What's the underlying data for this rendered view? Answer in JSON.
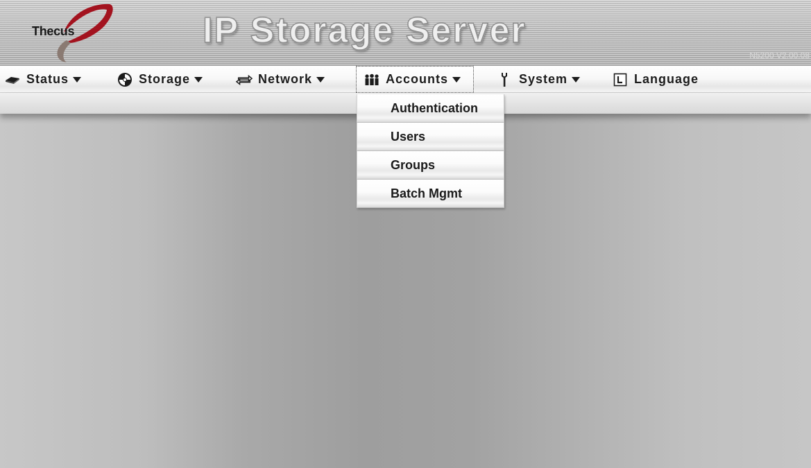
{
  "header": {
    "logo_text": "Thecus",
    "title": "IP Storage Server",
    "version": "N5200 V2.00.08"
  },
  "menu": {
    "items": [
      {
        "label": "Status",
        "icon": "hdd-icon"
      },
      {
        "label": "Storage",
        "icon": "disc-icon"
      },
      {
        "label": "Network",
        "icon": "network-arrows-icon"
      },
      {
        "label": "Accounts",
        "icon": "users-icon"
      },
      {
        "label": "System",
        "icon": "wrench-icon"
      },
      {
        "label": "Language",
        "icon": "language-icon"
      }
    ],
    "active": "Accounts"
  },
  "dropdown": {
    "items": [
      {
        "label": "Authentication"
      },
      {
        "label": "Users"
      },
      {
        "label": "Groups"
      },
      {
        "label": "Batch Mgmt"
      }
    ]
  },
  "colors": {
    "logo_accent": "#a3131f",
    "logo_swoosh": "#8a7a72",
    "menu_text": "#1c1c1c"
  }
}
